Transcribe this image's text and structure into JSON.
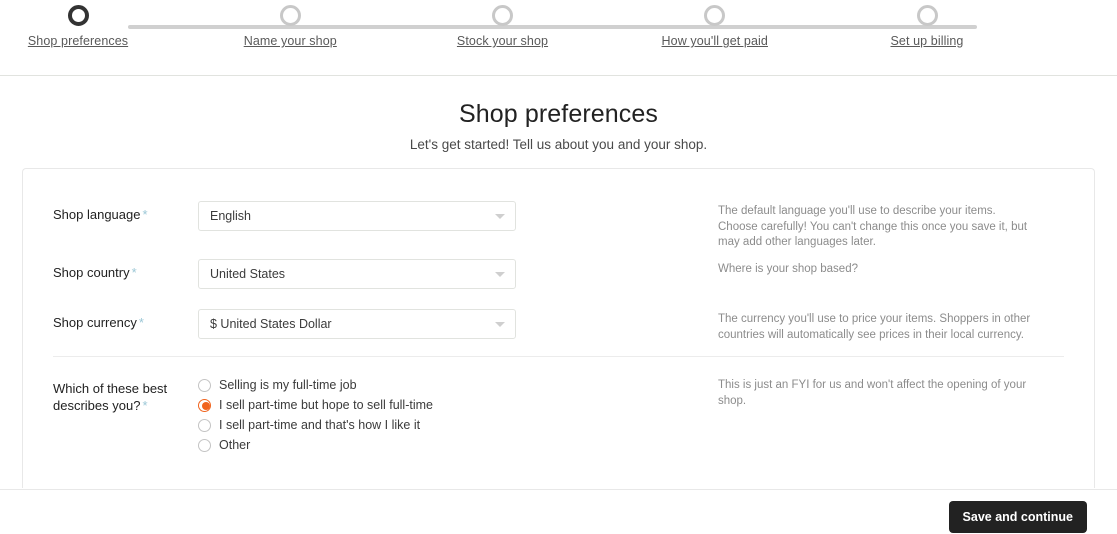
{
  "stepper": {
    "steps": [
      {
        "label": "Shop preferences",
        "state": "active"
      },
      {
        "label": "Name your shop",
        "state": "inactive"
      },
      {
        "label": "Stock your shop",
        "state": "inactive"
      },
      {
        "label": "How you'll get paid",
        "state": "inactive"
      },
      {
        "label": "Set up billing",
        "state": "inactive"
      }
    ]
  },
  "page": {
    "title": "Shop preferences",
    "subtitle": "Let's get started! Tell us about you and your shop."
  },
  "form": {
    "required_marker": "*",
    "fields": [
      {
        "label": "Shop language",
        "value": "English",
        "help": "The default language you'll use to describe your items. Choose carefully! You can't change this once you save it, but may add other languages later."
      },
      {
        "label": "Shop country",
        "value": "United States",
        "help": "Where is your shop based?"
      },
      {
        "label": "Shop currency",
        "value": "$ United States Dollar",
        "help": "The currency you'll use to price your items. Shoppers in other countries will automatically see prices in their local currency."
      }
    ],
    "question": {
      "label_line1": "Which of these best",
      "label_line2": "describes you?",
      "help": "This is just an FYI for us and won't affect the opening of your shop.",
      "options": [
        {
          "label": "Selling is my full-time job",
          "selected": false
        },
        {
          "label": "I sell part-time but hope to sell full-time",
          "selected": true
        },
        {
          "label": "I sell part-time and that's how I like it",
          "selected": false
        },
        {
          "label": "Other",
          "selected": false
        }
      ]
    }
  },
  "footer": {
    "save_label": "Save and continue"
  },
  "colors": {
    "accent_orange": "#f1641e",
    "required_asterisk": "#9bc7d6",
    "button_dark": "#222222",
    "step_active": "#333333",
    "step_inactive": "#c8c8c8"
  }
}
